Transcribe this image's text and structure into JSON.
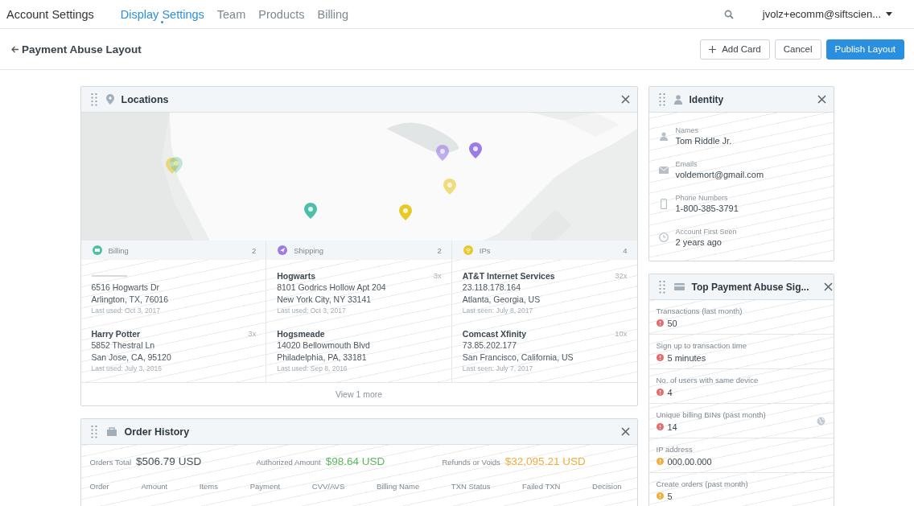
{
  "nav": {
    "title": "Account Settings",
    "tabs": [
      {
        "label": "Display Settings",
        "selected": true
      },
      {
        "label": "Team",
        "selected": false
      },
      {
        "label": "Products",
        "selected": false
      },
      {
        "label": "Billing",
        "selected": false
      }
    ],
    "account": "jvolz+ecomm@siftscien..."
  },
  "header": {
    "title": "Payment Abuse Layout",
    "buttons": [
      {
        "label": "Add Card",
        "kind": "add"
      },
      {
        "label": "Cancel",
        "kind": "plain"
      },
      {
        "label": "Publish Layout",
        "kind": "primary"
      }
    ]
  },
  "locations": {
    "title": "Locations",
    "columns": [
      {
        "title": "Billing",
        "count": "2",
        "color": "#4dbfa8",
        "kind": "card",
        "entries": [
          {
            "kind": "masked",
            "line1": "6516 Hogwarts Dr",
            "line2": "Arlington, TX, 76016",
            "note": "Last used: Oct 3, 2017"
          },
          {
            "kind": "named",
            "title": "Harry Potter",
            "count": "3x",
            "line1": "5852 Thestral Ln",
            "line2": "San Jose, CA, 95120",
            "note": "Last used: July 3, 2016"
          }
        ]
      },
      {
        "title": "Shipping",
        "count": "2",
        "color": "#9b7be6",
        "kind": "plane",
        "entries": [
          {
            "kind": "named",
            "title": "Hogwarts",
            "count": "3x",
            "line1": "8101 Godrics Hollow Apt 204",
            "line2": "New York City, NY 33141",
            "note": "Last used: Oct 3, 2017"
          },
          {
            "kind": "named",
            "title": "Hogsmeade",
            "line1": "14020 Bellowmouth Blvd",
            "line2": "Philadelphia, PA, 33181",
            "note": "Last used: Sep 8, 2016"
          }
        ]
      },
      {
        "title": "IPs",
        "count": "4",
        "color": "#e8c92a",
        "kind": "wifi",
        "entries": [
          {
            "kind": "named",
            "title": "AT&T Internet Services",
            "count": "32x",
            "line1": "23.118.178.164",
            "line2": "Atlanta, Georgia, US",
            "note": "Last seen: July 8, 2017"
          },
          {
            "kind": "named",
            "title": "Comcast Xfinity",
            "count": "10x",
            "line1": "73.85.202.177",
            "line2": "San Francisco, California, US",
            "note": "Last seen: July 7, 2017"
          }
        ]
      }
    ],
    "more": "View 1 more"
  },
  "orders": {
    "title": "Order History",
    "totals": [
      {
        "label": "Orders Total",
        "value": "$506.79 USD",
        "kind": "neutral"
      },
      {
        "label": "Authorized Amount",
        "value": "$98.64 USD",
        "kind": "good"
      },
      {
        "label": "Refunds or Voids",
        "value": "$32,095.21 USD",
        "kind": "warn"
      }
    ],
    "columns": [
      "Order",
      "Amount",
      "Items",
      "Payment",
      "CVV/AVS",
      "Billing Name",
      "TXN Status",
      "Failed TXN",
      "Decision"
    ]
  },
  "identity": {
    "title": "Identity",
    "items": [
      {
        "kind": "person",
        "label": "Names",
        "value": "Tom Riddle Jr."
      },
      {
        "kind": "mail",
        "label": "Emails",
        "value": "voldemort@gmail.com"
      },
      {
        "kind": "phone",
        "label": "Phone Numbers",
        "value": "1-800-385-3791"
      },
      {
        "kind": "clock",
        "label": "Account First Seen",
        "value": "2 years ago"
      }
    ]
  },
  "signals": {
    "title": "Top Payment Abuse Sig...",
    "items": [
      {
        "label": "Transactions (last month)",
        "value": "50",
        "kind": "high",
        "globe": false
      },
      {
        "label": "Sign up to transaction time",
        "value": "5 minutes",
        "kind": "high",
        "globe": false
      },
      {
        "label": "No. of users with same device",
        "value": "4",
        "kind": "high",
        "globe": false
      },
      {
        "label": "Unique billing BINs (past month)",
        "value": "14",
        "kind": "high",
        "globe": true
      },
      {
        "label": "IP address",
        "value": "000.00.000",
        "kind": "medium",
        "globe": false
      },
      {
        "label": "Create orders (past month)",
        "value": "5",
        "kind": "medium",
        "globe": false
      }
    ]
  }
}
